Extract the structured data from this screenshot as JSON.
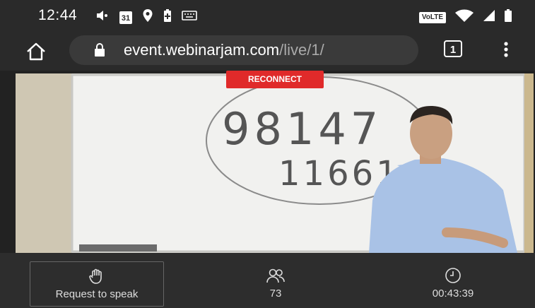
{
  "status_bar": {
    "time": "12:44",
    "left_icons": [
      "volume-icon",
      "calendar-icon",
      "location-icon",
      "battery-saver-icon",
      "keyboard-icon"
    ],
    "calendar_day": "31",
    "right_icons": [
      "volte-icon",
      "wifi-icon",
      "signal-icon",
      "battery-icon"
    ],
    "volte_text": "VoLTE"
  },
  "browser": {
    "url_main": "event.webinarjam.com",
    "url_path": "/live/1/",
    "tab_count": "1"
  },
  "video": {
    "banner": "RECONNECT",
    "board_text_line1": "98147",
    "board_text_line2": "11661"
  },
  "controls": {
    "request_label": "Request to speak",
    "attendees_count": "73",
    "timer": "00:43:39"
  }
}
